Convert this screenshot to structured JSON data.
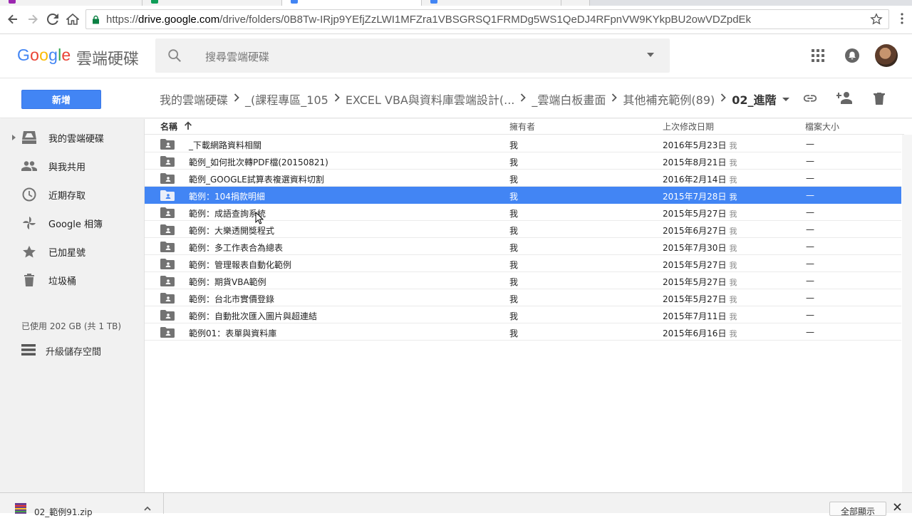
{
  "browser": {
    "url_scheme": "https://",
    "url_host": "drive.google.com",
    "url_path": "/drive/folders/0B8Tw-IRjp9YEfjZzLWI1MFZra1VBSGRSQ1FRMDg5WS1QeDJ4RFpnVW9KYkpBU2owVDZpdEk",
    "tab_colors": [
      "#9c27b0",
      "#0f9d58",
      "#4285f4",
      "#4285f4",
      "#bdbdbd"
    ]
  },
  "header": {
    "logo_letters": [
      {
        "ch": "G",
        "color": "#4285f4"
      },
      {
        "ch": "o",
        "color": "#ea4335"
      },
      {
        "ch": "o",
        "color": "#fbbc05"
      },
      {
        "ch": "g",
        "color": "#4285f4"
      },
      {
        "ch": "l",
        "color": "#34a853"
      },
      {
        "ch": "e",
        "color": "#ea4335"
      }
    ],
    "product_name": "雲端硬碟",
    "search_placeholder": "搜尋雲端硬碟"
  },
  "actions": {
    "new_label": "新增"
  },
  "breadcrumb": [
    {
      "label": "我的雲端硬碟",
      "current": false
    },
    {
      "label": "_(課程專區_105",
      "current": false
    },
    {
      "label": "EXCEL VBA與資料庫雲端設計(...",
      "current": false
    },
    {
      "label": "_雲端白板畫面",
      "current": false
    },
    {
      "label": "其他補充範例(89)",
      "current": false
    },
    {
      "label": "02_進階",
      "current": true
    }
  ],
  "sidebar": {
    "items": [
      {
        "label": "我的雲端硬碟",
        "icon": "my-drive-icon"
      },
      {
        "label": "與我共用",
        "icon": "shared-people-icon"
      },
      {
        "label": "近期存取",
        "icon": "clock-icon"
      },
      {
        "label": "Google 相簿",
        "icon": "photos-pinwheel-icon"
      },
      {
        "label": "已加星號",
        "icon": "star-icon"
      },
      {
        "label": "垃圾桶",
        "icon": "trash-icon"
      }
    ],
    "storage": "已使用 202 GB (共 1 TB)",
    "upgrade_label": "升級儲存空間"
  },
  "list": {
    "columns": {
      "name": "名稱",
      "owner": "擁有者",
      "modified": "上次修改日期",
      "size": "檔案大小"
    },
    "rows": [
      {
        "name": "_下載網路資料相關",
        "owner": "我",
        "date": "2016年5月23日",
        "by": "我",
        "size": "—",
        "selected": false
      },
      {
        "name": "範例_如何批次轉PDF檔(20150821)",
        "owner": "我",
        "date": "2015年8月21日",
        "by": "我",
        "size": "—",
        "selected": false
      },
      {
        "name": "範例_GOOGLE試算表複選資料切割",
        "owner": "我",
        "date": "2016年2月14日",
        "by": "我",
        "size": "—",
        "selected": false
      },
      {
        "name": "範例：104捐款明細",
        "owner": "我",
        "date": "2015年7月28日",
        "by": "我",
        "size": "—",
        "selected": true
      },
      {
        "name": "範例：成語查詢系統",
        "owner": "我",
        "date": "2015年5月27日",
        "by": "我",
        "size": "—",
        "selected": false
      },
      {
        "name": "範例：大樂透開獎程式",
        "owner": "我",
        "date": "2015年6月27日",
        "by": "我",
        "size": "—",
        "selected": false
      },
      {
        "name": "範例：多工作表合為總表",
        "owner": "我",
        "date": "2015年7月30日",
        "by": "我",
        "size": "—",
        "selected": false
      },
      {
        "name": "範例：管理報表自動化範例",
        "owner": "我",
        "date": "2015年5月27日",
        "by": "我",
        "size": "—",
        "selected": false
      },
      {
        "name": "範例：期貨VBA範例",
        "owner": "我",
        "date": "2015年5月27日",
        "by": "我",
        "size": "—",
        "selected": false
      },
      {
        "name": "範例：台北市實價登錄",
        "owner": "我",
        "date": "2015年5月27日",
        "by": "我",
        "size": "—",
        "selected": false
      },
      {
        "name": "範例：自動批次匯入圖片與超連結",
        "owner": "我",
        "date": "2015年7月11日",
        "by": "我",
        "size": "—",
        "selected": false
      },
      {
        "name": "範例01：表單與資料庫",
        "owner": "我",
        "date": "2015年6月16日",
        "by": "我",
        "size": "—",
        "selected": false
      }
    ]
  },
  "downloads": {
    "file_name": "02_範例91.zip",
    "show_all": "全部顯示"
  },
  "colors": {
    "accent": "#4285f4",
    "icon_gray": "#737373"
  }
}
